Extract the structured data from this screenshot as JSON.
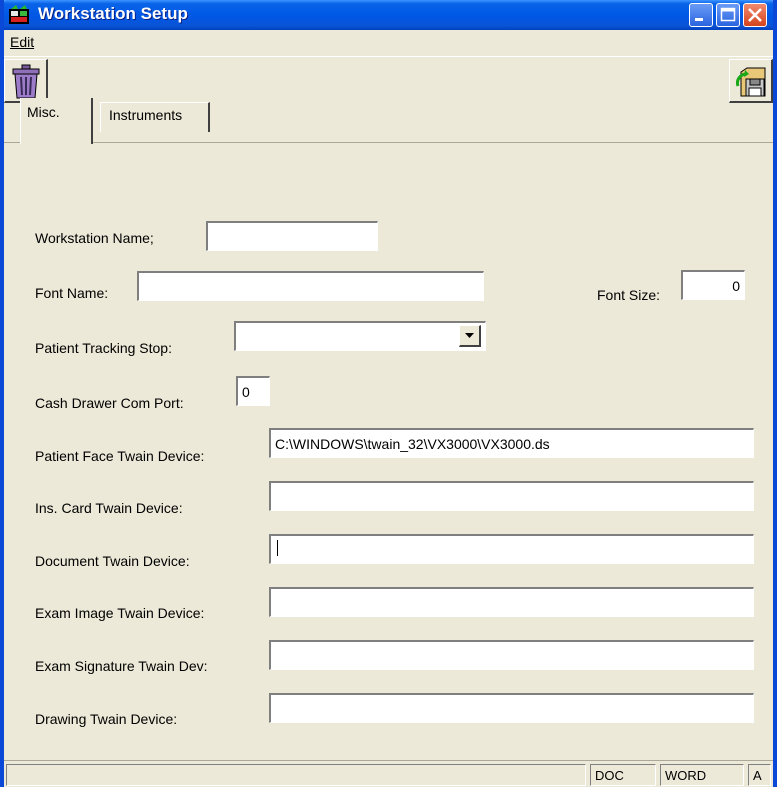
{
  "window": {
    "title": "Workstation Setup"
  },
  "menu": {
    "items": [
      {
        "label": "Edit"
      }
    ]
  },
  "toolbar": {
    "left_button": {
      "icon": "trash-can-icon"
    },
    "right_button": {
      "icon": "save-disk-icon"
    }
  },
  "tabs": [
    {
      "label": "Misc."
    },
    {
      "label": "Instruments"
    }
  ],
  "form": {
    "workstation_name": {
      "label": "Workstation Name;",
      "value": ""
    },
    "font_name": {
      "label": "Font Name:",
      "value": ""
    },
    "font_size": {
      "label": "Font Size:",
      "value": "0"
    },
    "patient_tracking_stop": {
      "label": "Patient Tracking Stop:",
      "value": ""
    },
    "cash_drawer_com_port": {
      "label": "Cash Drawer Com Port:",
      "value": "0"
    },
    "patient_face_twain": {
      "label": "Patient Face Twain Device:",
      "value": "C:\\WINDOWS\\twain_32\\VX3000\\VX3000.ds"
    },
    "ins_card_twain": {
      "label": "Ins. Card Twain Device:",
      "value": ""
    },
    "document_twain": {
      "label": "Document Twain Device:",
      "value": ""
    },
    "exam_image_twain": {
      "label": "Exam Image Twain Device:",
      "value": ""
    },
    "exam_signature_twain": {
      "label": "Exam Signature Twain Dev:",
      "value": ""
    },
    "drawing_twain": {
      "label": "Drawing Twain Device:",
      "value": ""
    }
  },
  "statusbar": {
    "panels": [
      {
        "text": ""
      },
      {
        "text": "DOC"
      },
      {
        "text": "WORD"
      },
      {
        "text": "A"
      }
    ]
  },
  "colors": {
    "titlebar": "#0058E6",
    "window_bg": "#ECE9D8",
    "close_button": "#D5441C"
  }
}
